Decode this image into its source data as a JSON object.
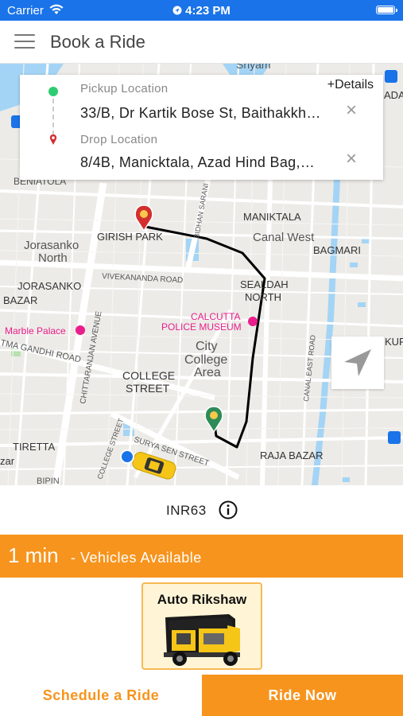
{
  "status_bar": {
    "carrier": "Carrier",
    "time": "4:23 PM"
  },
  "nav": {
    "title": "Book a Ride",
    "menu_icon": "hamburger-menu-icon"
  },
  "map": {
    "labels": {
      "shyam": "Shyam",
      "beniatola": "BENIATOLA",
      "girish_park": "GIRISH PARK",
      "bidhan_sarani": "BIDHAN SARANI",
      "maniktala": "MANIKTALA",
      "canal_west": "Canal West",
      "bagmari": "BAGMARI",
      "jorasanko_north_1": "Jorasanko",
      "jorasanko_north_2": "North",
      "vivekananda_road": "VIVEKANANDA ROAD",
      "sealdah_1": "SEALDAH",
      "sealdah_2": "NORTH",
      "jorasanko": "JORASANKO",
      "bazar": "BAZAR",
      "calcutta_police_1": "CALCUTTA",
      "calcutta_police_2": "POLICE MUSEUM",
      "marble_palace": "Marble Palace",
      "gandhi_road": "TMA GANDHI ROAD",
      "city_college_1": "City",
      "city_college_2": "College",
      "city_college_3": "Area",
      "college_street_1": "COLLEGE",
      "college_street_2": "STREET",
      "chittaranjan_avenue": "CHITTARANJAN AVENUE",
      "canal_east_road": "CANAL EAST ROAD",
      "kur": "KUR",
      "tiretta": "TIRETTA",
      "zar": "zar",
      "college_street_road": "COLLEGE STREET",
      "surya_sen_street": "SURYA SEN STREET",
      "raja_bazar": "RAJA BAZAR",
      "adab": "ADAB",
      "bip": "BIPIN"
    },
    "colors": {
      "background": "#ecebe7",
      "road": "#ffffff",
      "water": "#a4d4f5",
      "route": "#000000",
      "pickup_pin": "#2e8b57",
      "drop_pin": "#d32f2f",
      "poi_pink": "#e91e8c"
    }
  },
  "locations": {
    "pickup_label": "Pickup Location",
    "pickup_value": "33/B, Dr Kartik Bose St, Baithakkh…",
    "drop_label": "Drop Location",
    "drop_value": "8/4B, Manicktala, Azad Hind Bag,…",
    "details_link": "+Details",
    "clear_icon": "close-icon"
  },
  "fare": {
    "amount": "INR63",
    "info_icon": "info-icon"
  },
  "eta": {
    "time": "1 min",
    "suffix": "- Vehicles Available"
  },
  "vehicle": {
    "name": "Auto Rikshaw",
    "selected": true
  },
  "actions": {
    "schedule": "Schedule a Ride",
    "ride_now": "Ride Now"
  },
  "theme": {
    "accent": "#f7941d",
    "status_bar": "#1a73e8"
  }
}
